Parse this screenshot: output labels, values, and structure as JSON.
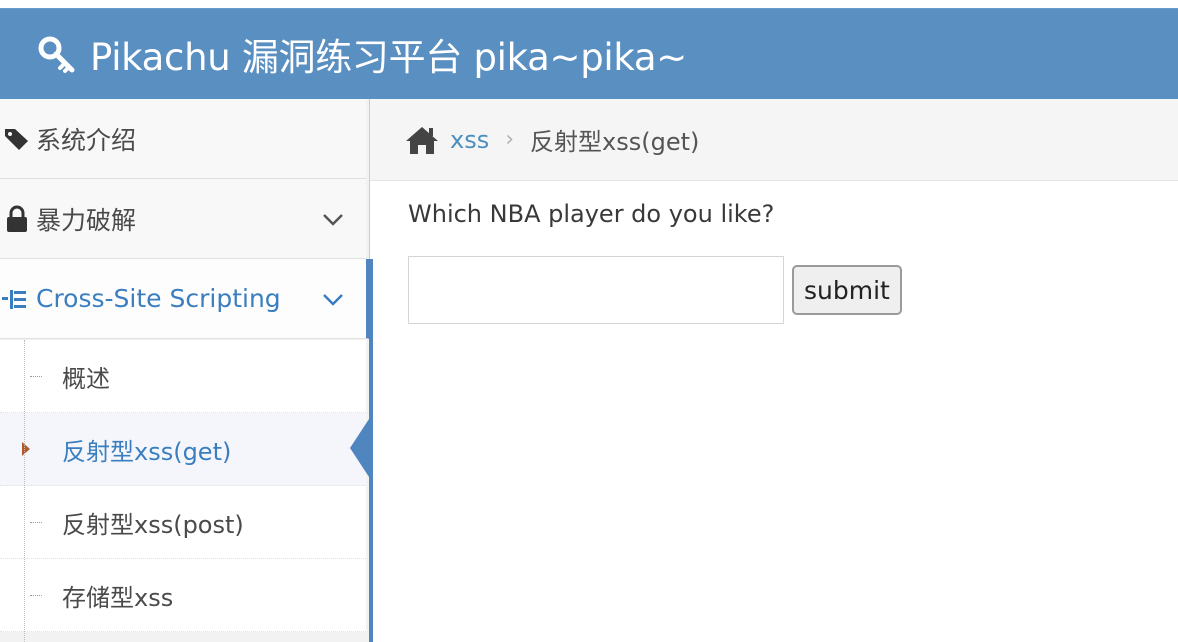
{
  "header": {
    "title": "Pikachu 漏洞练习平台 pika~pika~",
    "icon": "key-icon"
  },
  "sidebar": {
    "items": [
      {
        "label": "系统介绍",
        "icon": "tags-icon"
      },
      {
        "label": "暴力破解",
        "icon": "lock-icon"
      },
      {
        "label": "Cross-Site Scripting",
        "icon": "sitemap-icon"
      }
    ],
    "subitems": [
      {
        "label": "概述"
      },
      {
        "label": "反射型xss(get)"
      },
      {
        "label": "反射型xss(post)"
      },
      {
        "label": "存储型xss"
      }
    ]
  },
  "breadcrumb": {
    "home_icon": "home-icon",
    "link": "xss",
    "separator": "›",
    "current": "反射型xss(get)"
  },
  "main": {
    "question": "Which NBA player do you like?",
    "input_value": "",
    "submit_label": "submit"
  },
  "colors": {
    "navbar": "#5a8fc1",
    "accent": "#4f86c0",
    "link": "#3a7ebf"
  }
}
